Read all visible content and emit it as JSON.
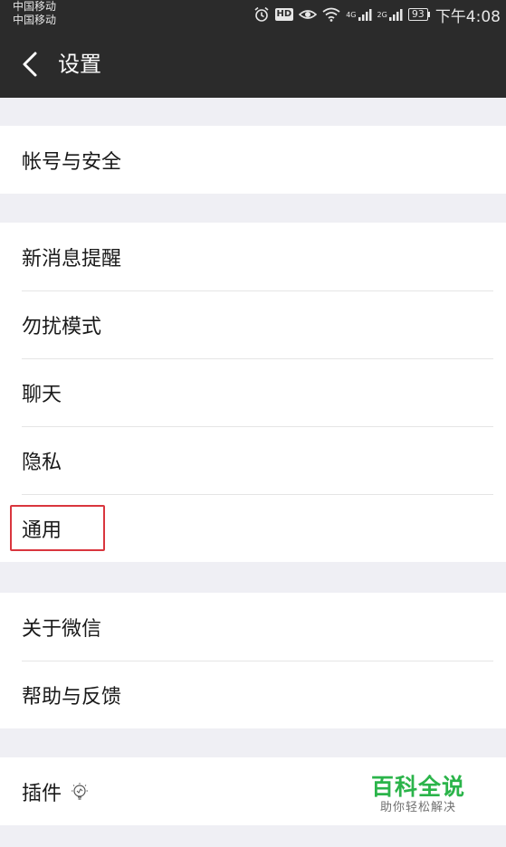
{
  "status_bar": {
    "carrier_1": "中国移动",
    "carrier_2": "中国移动",
    "hd": "HD",
    "net_1": "4G",
    "net_2": "2G",
    "battery": "93",
    "time": "下午4:08"
  },
  "header": {
    "title": "设置"
  },
  "groups": [
    {
      "items": [
        {
          "label": "帐号与安全"
        }
      ]
    },
    {
      "items": [
        {
          "label": "新消息提醒"
        },
        {
          "label": "勿扰模式"
        },
        {
          "label": "聊天"
        },
        {
          "label": "隐私"
        },
        {
          "label": "通用"
        }
      ]
    },
    {
      "items": [
        {
          "label": "关于微信"
        },
        {
          "label": "帮助与反馈"
        }
      ]
    },
    {
      "items": [
        {
          "label": "插件"
        }
      ]
    }
  ],
  "watermark": {
    "title": "百科全说",
    "subtitle": "助你轻松解决"
  },
  "colors": {
    "header_bg": "#2b2b2b",
    "page_bg": "#efeff4",
    "highlight": "#d9363e",
    "watermark": "#2bb44a"
  }
}
